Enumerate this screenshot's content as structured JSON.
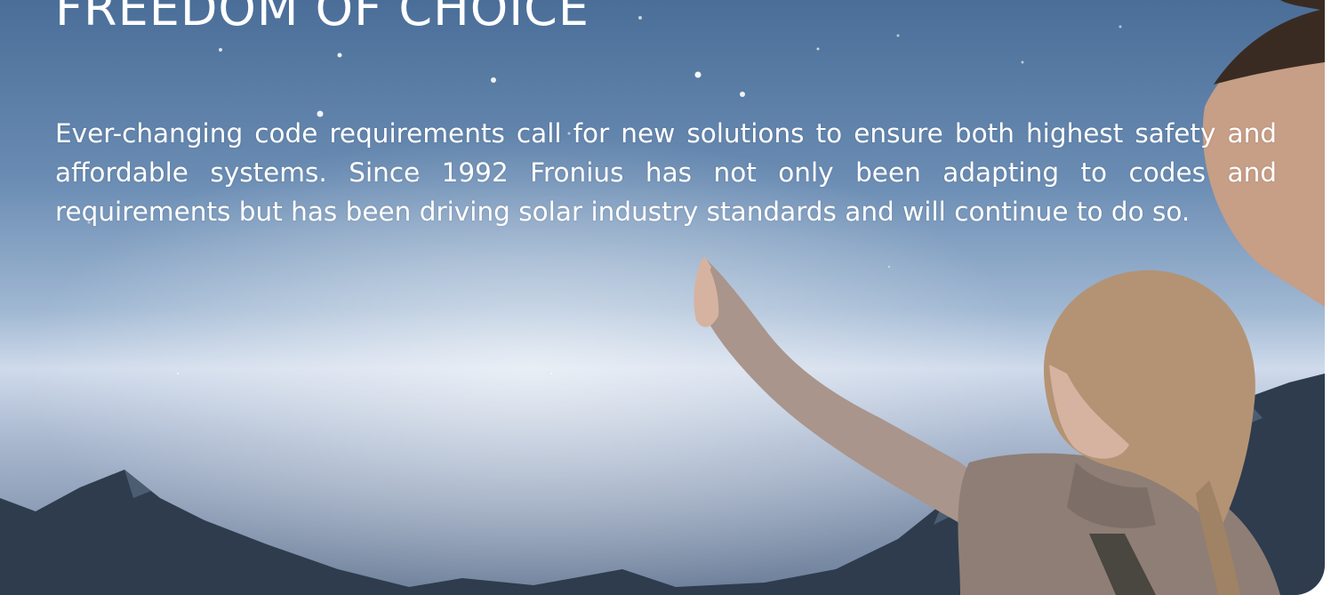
{
  "headline": "FREEDOM OF CHOICE",
  "body": "Ever-changing code requirements call for new solutions to ensure both highest safety and affordable systems. Since 1992 Fronius has not only been adapting to codes and requirements but has been driving solar industry standards and will continue to do so.",
  "colors": {
    "sky_top": "#4a6e98",
    "horizon": "#cfdaeb",
    "mountains": "#2e3c4e",
    "text": "#ffffff"
  }
}
